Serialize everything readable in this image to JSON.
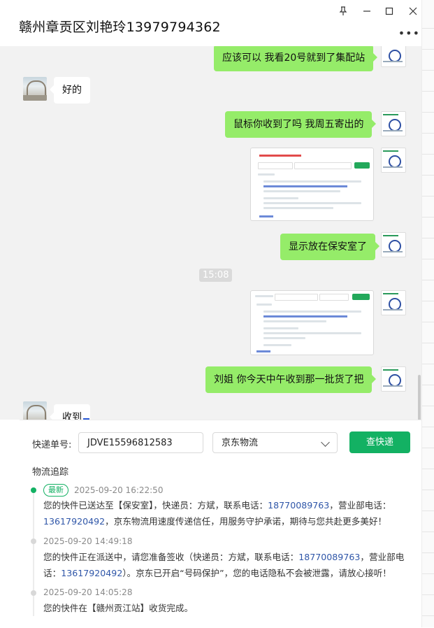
{
  "window": {
    "title": "赣州章贡区刘艳玲13979794362",
    "pin_icon": "pin-icon",
    "minimize_icon": "minimize-icon",
    "maximize_icon": "maximize-icon",
    "close_icon": "close-icon",
    "more_icon": "more-icon"
  },
  "chat": {
    "messages": [
      {
        "side": "me",
        "text": "应该可以  我看20号就到了集配站"
      },
      {
        "side": "them",
        "text": "好的"
      },
      {
        "side": "me",
        "text": "鼠标你收到了吗  我周五寄出的"
      },
      {
        "side": "me",
        "type": "image"
      },
      {
        "side": "me",
        "text": "显示放在保安室了"
      },
      {
        "side": "me",
        "type": "image"
      },
      {
        "side": "me",
        "text": "刘姐  你今天中午收到那一批货了把"
      },
      {
        "side": "them",
        "text": "收到"
      }
    ],
    "time_separator": "15:08"
  },
  "tracking": {
    "number_label": "快递单号:",
    "number_value": "JDVE15596812583",
    "carrier_value": "京东物流",
    "query_button": "查快递",
    "section_title": "物流追踪",
    "latest_tag": "最新",
    "events": [
      {
        "time": "2025-09-20 16:22:50",
        "text_a": "您的快件已送达至【保安室】，快递员：方斌，联系电话：",
        "phone1": "18770089763",
        "text_b": "，营业部电话：",
        "phone2": "13617920492",
        "text_c": "，京东物流用速度传递信任，用服务守护承诺，期待与您共赴更多美好！"
      },
      {
        "time": "2025-09-20 14:49:18",
        "text_a": "您的快件正在派送中，请您准备签收（快递员：方斌，联系电话：",
        "phone1": "18770089763",
        "text_b": "，营业部电话：",
        "phone2": "13617920492",
        "text_c": "）。京东已开启“号码保护”，您的电话隐私不会被泄露，请放心接听！"
      },
      {
        "time": "2025-09-20 14:05:28",
        "text_a": "您的快件在【赣州贡江站】收货完成。"
      }
    ]
  }
}
